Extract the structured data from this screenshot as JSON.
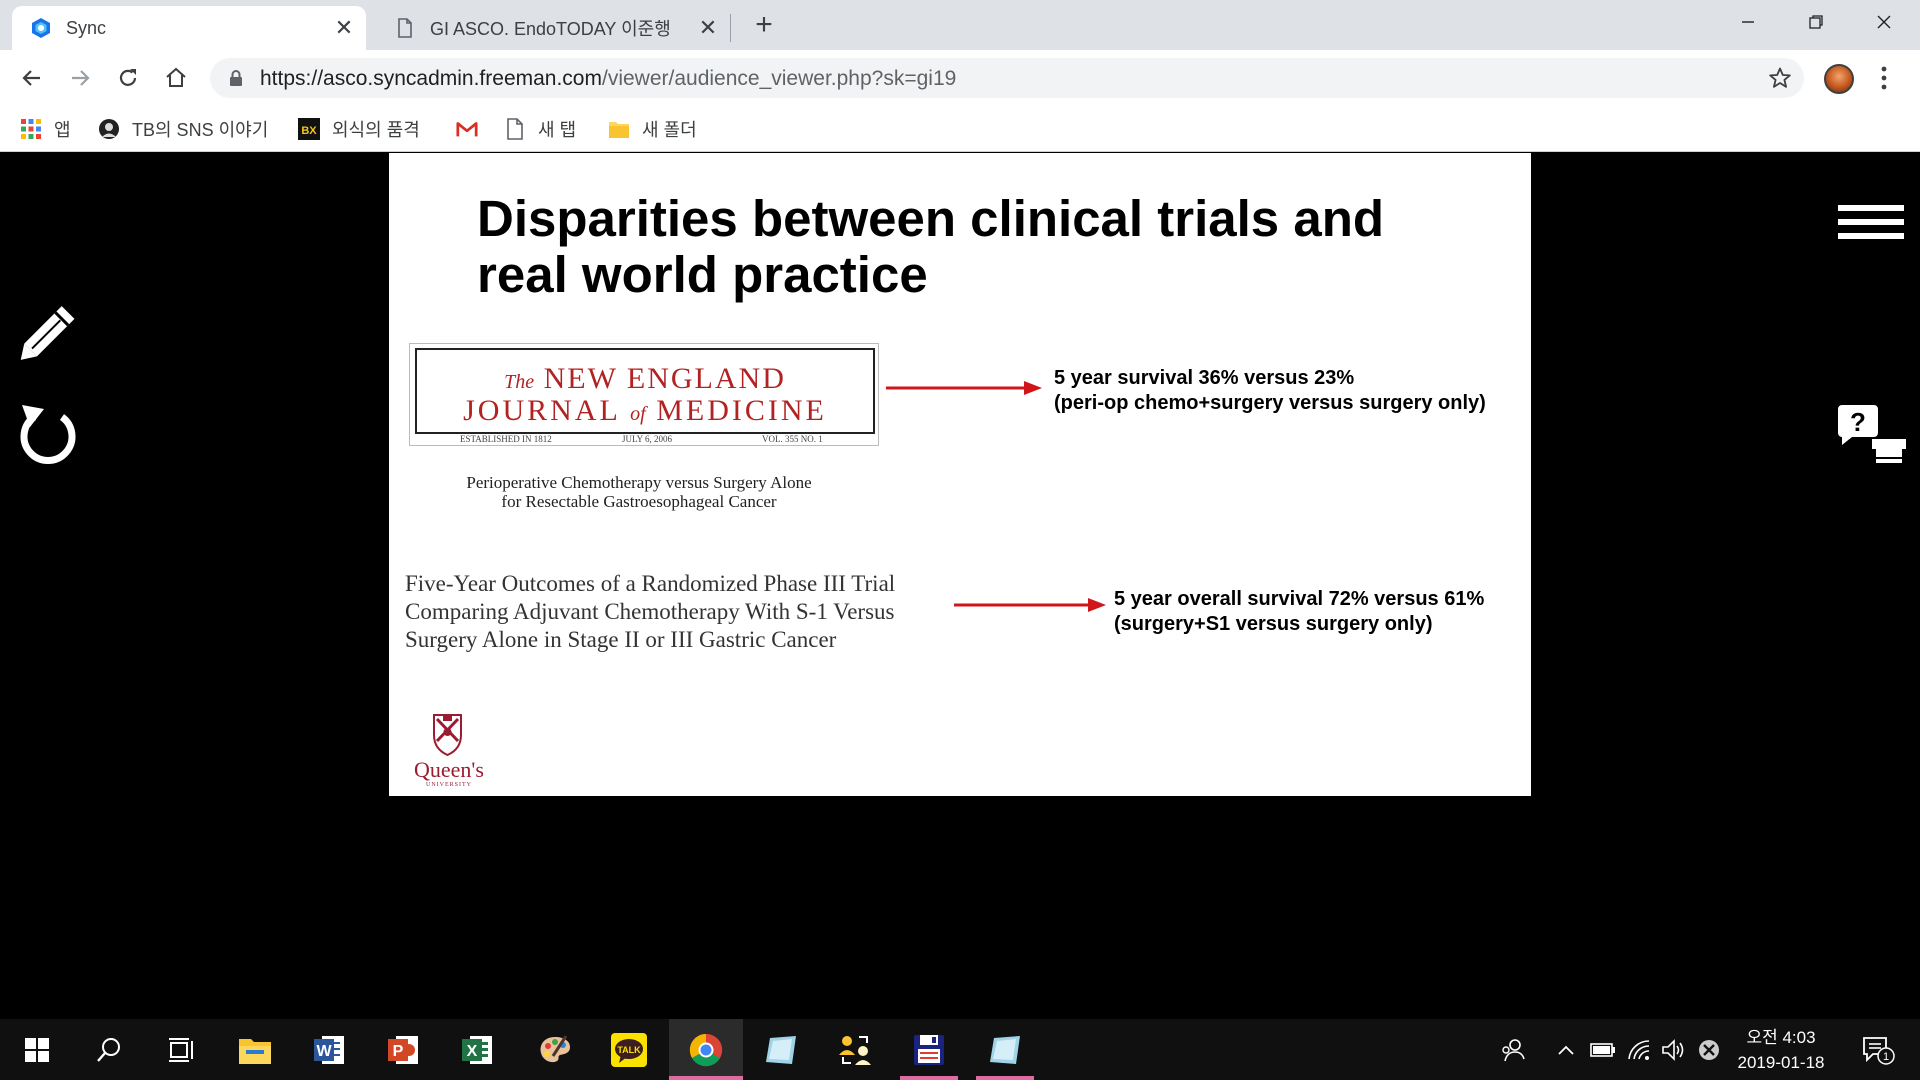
{
  "browser": {
    "tabs": [
      {
        "title": "Sync",
        "active": true,
        "close": "✕"
      },
      {
        "title": "GI ASCO. EndoTODAY 이준행",
        "active": false,
        "close": "✕"
      }
    ],
    "new_tab": "+",
    "url_host": "https://asco.syncadmin.freeman.com",
    "url_path": "/viewer/audience_viewer.php?sk=gi19",
    "bookmarks": [
      {
        "label": "앱",
        "icon": "apps-grid-icon"
      },
      {
        "label": "TB의 SNS 이야기",
        "icon": "profile-silhouette-icon"
      },
      {
        "label": "외식의 품격",
        "icon": "bx-logo-icon"
      },
      {
        "label": "",
        "icon": "gmail-icon"
      },
      {
        "label": "새 탭",
        "icon": "page-icon"
      },
      {
        "label": "새 폴더",
        "icon": "folder-icon"
      }
    ]
  },
  "slide": {
    "title_line1": "Disparities between clinical trials and",
    "title_line2": "real world practice",
    "journal": {
      "the": "The",
      "line1": "NEW ENGLAND",
      "journal_word": "JOURNAL",
      "of": "of",
      "medicine": "MEDICINE",
      "established": "ESTABLISHED IN 1812",
      "date": "JULY 6, 2006",
      "volume": "VOL. 355   NO. 1"
    },
    "article1_line1": "Perioperative Chemotherapy versus Surgery Alone",
    "article1_line2": "for Resectable Gastroesophageal Cancer",
    "finding1_line1": "5 year survival 36% versus 23%",
    "finding1_line2": "(peri-op chemo+surgery versus surgery only)",
    "article2_line1": "Five-Year Outcomes of a Randomized Phase III Trial",
    "article2_line2": "Comparing Adjuvant Chemotherapy With S-1 Versus",
    "article2_line3": "Surgery Alone in Stage II or III Gastric Cancer",
    "finding2_line1": "5 year overall survival 72% versus 61%",
    "finding2_line2": "(surgery+S1 versus surgery only)",
    "logo_text": "Queen's",
    "logo_sub": "UNIVERSITY"
  },
  "taskbar": {
    "clock_time": "오전 4:03",
    "clock_date": "2019-01-18",
    "notification_count": "1",
    "word_letter": "W",
    "ppt_letter": "P",
    "excel_letter": "X",
    "talk_label": "TALK"
  },
  "colors": {
    "accent_red": "#d0161b",
    "nejm_red": "#b22222",
    "taskbar_indicator": "#e06ba2"
  }
}
